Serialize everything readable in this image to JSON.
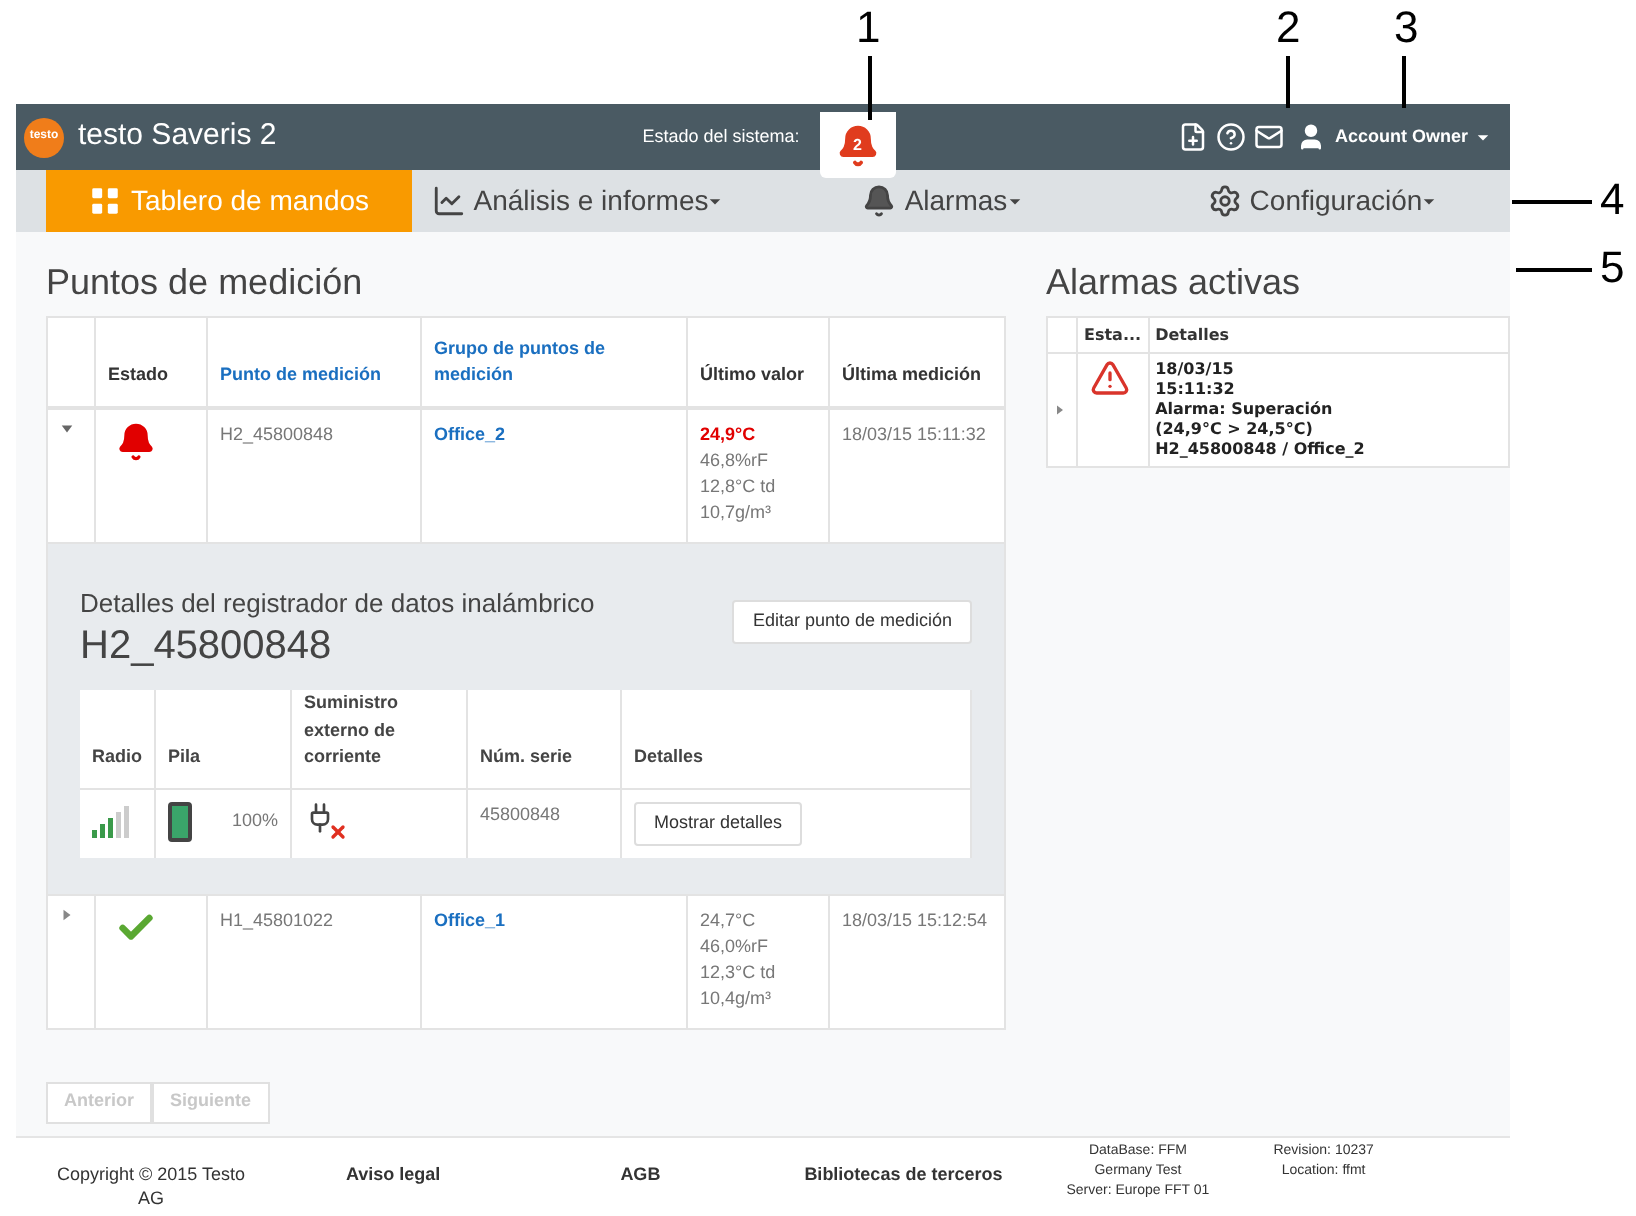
{
  "callouts": [
    "1",
    "2",
    "3",
    "4",
    "5"
  ],
  "header": {
    "logo": "testo",
    "title": "testo Saveris 2",
    "status_label": "Estado del sistema:",
    "alarm_count": "2",
    "user": "Account Owner"
  },
  "nav": [
    {
      "label": "Tablero de mandos",
      "kind": "grid",
      "selected": true,
      "dropdown": false
    },
    {
      "label": "Análisis e informes",
      "kind": "chart",
      "selected": false,
      "dropdown": true
    },
    {
      "label": "Alarmas",
      "kind": "bell",
      "selected": false,
      "dropdown": true
    },
    {
      "label": "Configuración",
      "kind": "gear",
      "selected": false,
      "dropdown": true
    }
  ],
  "measuring_points": {
    "title": "Puntos de medición",
    "columns": [
      "Estado",
      "Punto de medición",
      "Grupo de puntos de medición",
      "Último valor",
      "Última medición"
    ],
    "rows": [
      {
        "expanded": true,
        "kind": "alarm",
        "point": "H2_45800848",
        "group": "Office_2",
        "values": [
          {
            "text": "24,9°C",
            "alarm": true
          },
          {
            "text": "46,8%rF",
            "alarm": false
          },
          {
            "text": "12,8°C td",
            "alarm": false
          },
          {
            "text": "10,7g/m³",
            "alarm": false
          }
        ],
        "time": "18/03/15 15:11:32",
        "details": {
          "subtitle": "Detalles del registrador de datos inalámbrico",
          "name": "H2_45800848",
          "edit_button": "Editar punto de medición",
          "columns": [
            "Radio",
            "Pila",
            "Suministro externo de corriente",
            "Núm. serie",
            "Detalles"
          ],
          "battery": {
            "level": 1,
            "text": "100%"
          },
          "external_power": false,
          "serial": "45800848",
          "details_button": "Mostrar detalles"
        }
      },
      {
        "expanded": false,
        "kind": "ok",
        "point": "H1_45801022",
        "group": "Office_1",
        "values": [
          {
            "text": "24,7°C",
            "alarm": false
          },
          {
            "text": "46,0%rF",
            "alarm": false
          },
          {
            "text": "12,3°C td",
            "alarm": false
          },
          {
            "text": "10,4g/m³",
            "alarm": false
          }
        ],
        "time": "18/03/15 15:12:54"
      }
    ]
  },
  "pagination": [
    {
      "label": "Anterior",
      "disabled": true
    },
    {
      "label": "Siguiente",
      "disabled": true
    }
  ],
  "active_alarms": {
    "title": "Alarmas activas",
    "columns": [
      "Esta...",
      "Detalles"
    ],
    "rows": [
      {
        "expanded": false,
        "lines": [
          "18/03/15",
          "15:11:32",
          "Alarma: Superación",
          "(24,9°C > 24,5°C)",
          "H2_45800848 / Office_2"
        ]
      }
    ]
  },
  "footer": {
    "copyright": "Copyright © 2015 Testo AG",
    "links": [
      "Aviso legal",
      "AGB",
      "Bibliotecas de terceros"
    ],
    "server": [
      "DataBase: FFM",
      "Germany Test",
      "Server: Europe FFT 01"
    ],
    "revision": [
      "Revision: 10237",
      "Location: ffmt"
    ]
  }
}
